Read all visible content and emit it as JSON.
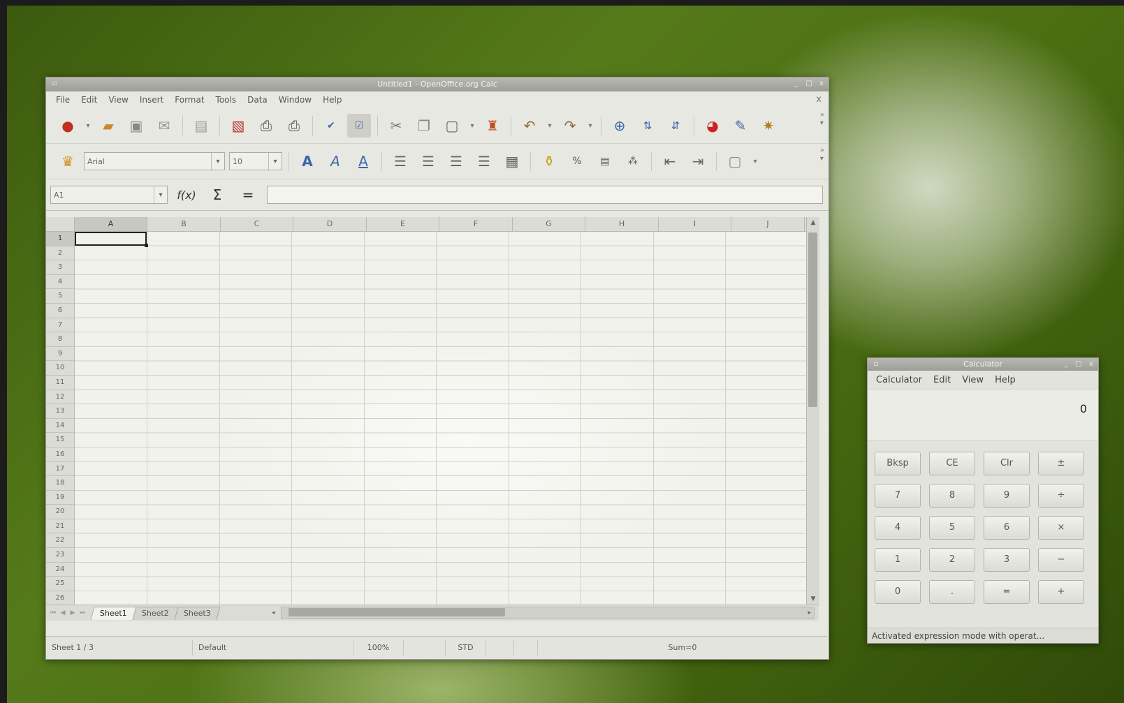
{
  "calc": {
    "title": "Untitled1 - OpenOffice.org Calc",
    "window_controls": {
      "minimize": "_",
      "maximize": "□",
      "close": "x"
    },
    "menu": [
      "File",
      "Edit",
      "View",
      "Insert",
      "Format",
      "Tools",
      "Data",
      "Window",
      "Help"
    ],
    "doc_close": "x",
    "toolbar_icons": [
      "new-icon",
      "open-icon",
      "save-icon",
      "email-icon",
      "edit-file-icon",
      "export-pdf-icon",
      "print-icon",
      "page-preview-icon",
      "spellcheck-icon",
      "autospellcheck-icon",
      "cut-icon",
      "copy-icon",
      "paste-icon",
      "format-paintbrush-icon",
      "undo-icon",
      "redo-icon",
      "hyperlink-icon",
      "sort-ascending-icon",
      "sort-descending-icon",
      "chart-icon",
      "show-draw-icon",
      "navigator-icon"
    ],
    "format_toolbar": {
      "font_name": "Arial",
      "font_size": "10"
    },
    "name_box": "A1",
    "formula_buttons": {
      "function_wizard": "f(x)",
      "sum": "Σ",
      "function": "="
    },
    "columns": [
      "A",
      "B",
      "C",
      "D",
      "E",
      "F",
      "G",
      "H",
      "I",
      "J"
    ],
    "rows": [
      "1",
      "2",
      "3",
      "4",
      "5",
      "6",
      "7",
      "8",
      "9",
      "10",
      "11",
      "12",
      "13",
      "14",
      "15",
      "16",
      "17",
      "18",
      "19",
      "20",
      "21",
      "22",
      "23",
      "24",
      "25",
      "26"
    ],
    "sheet_tabs": [
      "Sheet1",
      "Sheet2",
      "Sheet3"
    ],
    "status": {
      "sheet": "Sheet 1 / 3",
      "page_style": "Default",
      "zoom": "100%",
      "mode": "STD",
      "sum": "Sum=0"
    }
  },
  "calculator": {
    "title": "Calculator",
    "menu": [
      "Calculator",
      "Edit",
      "View",
      "Help"
    ],
    "display": "0",
    "keys": [
      "Bksp",
      "CE",
      "Clr",
      "±",
      "7",
      "8",
      "9",
      "÷",
      "4",
      "5",
      "6",
      "×",
      "1",
      "2",
      "3",
      "−",
      "0",
      ".",
      "=",
      "+"
    ],
    "status": "Activated expression mode with operat..."
  }
}
